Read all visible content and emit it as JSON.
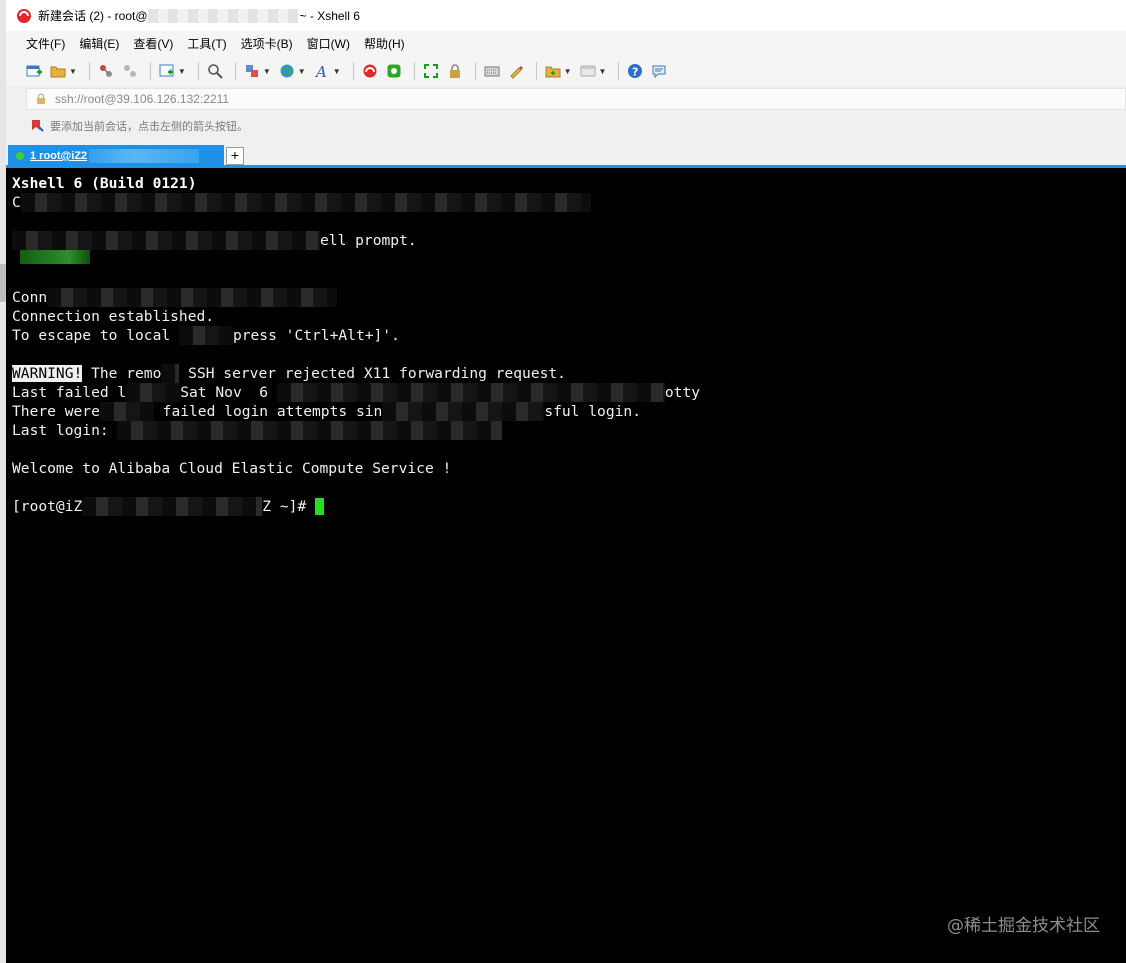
{
  "colors": {
    "tab_active": "#1e90e6",
    "terminal_bg": "#000000",
    "terminal_fg": "#f0f0f0",
    "cursor": "#1fe01f",
    "connected_dot": "#36d436"
  },
  "titlebar": {
    "icon": "xshell-logo-icon",
    "title_prefix": "新建会话 (2) - root@",
    "title_suffix": "~ - Xshell 6"
  },
  "menubar": {
    "items": [
      {
        "label": "文件(F)"
      },
      {
        "label": "编辑(E)"
      },
      {
        "label": "查看(V)"
      },
      {
        "label": "工具(T)"
      },
      {
        "label": "选项卡(B)"
      },
      {
        "label": "窗口(W)"
      },
      {
        "label": "帮助(H)"
      }
    ]
  },
  "toolbar": {
    "icons": [
      "new-session-icon",
      "open-folder-icon",
      "connect-icon",
      "disconnect-icon",
      "new-tab-icon",
      "find-icon",
      "properties-icon",
      "globe-icon",
      "font-icon",
      "xftp-icon",
      "xagent-icon",
      "fullscreen-icon",
      "lock-icon",
      "keyboard-icon",
      "highlight-icon",
      "folder-icon",
      "layout-icon",
      "help-icon",
      "chat-icon"
    ]
  },
  "addressbar": {
    "value": "ssh://root@39.106.126.132:2211"
  },
  "hintbar": {
    "text": "要添加当前会话，点击左侧的箭头按钮。"
  },
  "tabs": [
    {
      "label": "1 root@iZ2"
    }
  ],
  "terminal": {
    "lines": [
      {
        "text": "Xshell 6 (Build 0121)"
      },
      {
        "prefix": "C",
        "suffix": ""
      },
      {
        "prefix": "",
        "suffix": ""
      },
      {
        "prefix": "",
        "suffix": "ell prompt."
      },
      {
        "prefix": "",
        "suffix": ""
      },
      {
        "prefix": "",
        "suffix": ""
      },
      {
        "prefix": "Conn",
        "suffix": ""
      },
      {
        "text": "Connection established."
      },
      {
        "prefix": "To escape to local ",
        "suffix": "press 'Ctrl+Alt+]'."
      },
      {
        "text": ""
      },
      {
        "warning": "WARNING!",
        "rest_a": " The remo",
        "rest_b": " SSH server rejected X11 forwarding request."
      },
      {
        "prefix": "Last failed l",
        "mid": "Sat Nov  6 ",
        "suffix": "otty"
      },
      {
        "prefix": "There were",
        "mid": " failed login attempts sin",
        "suffix": "sful login."
      },
      {
        "prefix": "Last login: ",
        "suffix": ""
      },
      {
        "text": ""
      },
      {
        "text": "Welcome to Alibaba Cloud Elastic Compute Service !"
      },
      {
        "text": ""
      },
      {
        "prefix": "[root@iZ",
        "suffix": "Z ~]# "
      }
    ]
  },
  "watermark": "@稀土掘金技术社区"
}
